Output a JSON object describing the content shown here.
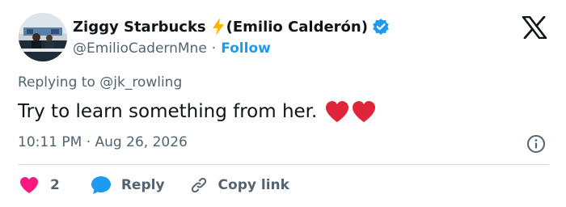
{
  "author": {
    "display_name": "Ziggy Starbucks",
    "display_name_suffix": "(Emilio Calderón)",
    "handle": "@EmilioCadernMne",
    "follow_label": "Follow",
    "separator": "·"
  },
  "tweet": {
    "replying_prefix": "Replying to",
    "replying_to": "@jk_rowling",
    "text": "Try to learn something from her.",
    "timestamp": "10:11 PM · Aug 26, 2026"
  },
  "actions": {
    "like_count": "2",
    "reply_label": "Reply",
    "copy_link_label": "Copy link"
  },
  "colors": {
    "accent": "#1d9bf0",
    "like": "#f91880",
    "muted": "#536471",
    "text": "#0f1419",
    "heart_emoji": "#e0243a",
    "bolt": "#ffb400"
  },
  "icons": [
    "bolt-icon",
    "verified-icon",
    "x-logo-icon",
    "heart-emoji-icon",
    "info-icon",
    "like-icon",
    "reply-icon",
    "link-icon"
  ]
}
